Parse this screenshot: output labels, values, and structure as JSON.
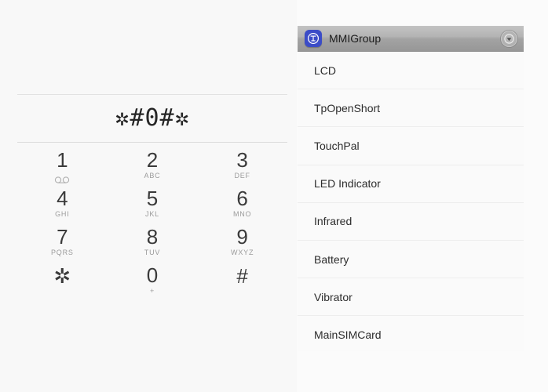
{
  "dialer": {
    "display_value": "✲#0#✲",
    "keys": [
      {
        "digit": "1",
        "sub": "",
        "icon": "voicemail-icon"
      },
      {
        "digit": "2",
        "sub": "ABC",
        "icon": ""
      },
      {
        "digit": "3",
        "sub": "DEF",
        "icon": ""
      },
      {
        "digit": "4",
        "sub": "GHI",
        "icon": ""
      },
      {
        "digit": "5",
        "sub": "JKL",
        "icon": ""
      },
      {
        "digit": "6",
        "sub": "MNO",
        "icon": ""
      },
      {
        "digit": "7",
        "sub": "PQRS",
        "icon": ""
      },
      {
        "digit": "8",
        "sub": "TUV",
        "icon": ""
      },
      {
        "digit": "9",
        "sub": "WXYZ",
        "icon": ""
      },
      {
        "digit": "✲",
        "sub": "",
        "icon": ""
      },
      {
        "digit": "0",
        "sub": "+",
        "icon": ""
      },
      {
        "digit": "#",
        "sub": "",
        "icon": ""
      }
    ]
  },
  "mmi": {
    "title": "MMIGroup",
    "app_icon": "mmi-app-icon",
    "menu_icon": "chevron-down-circle-icon",
    "accent_color": "#3b4cc7",
    "items": [
      {
        "label": "LCD"
      },
      {
        "label": "TpOpenShort"
      },
      {
        "label": "TouchPal"
      },
      {
        "label": "LED Indicator"
      },
      {
        "label": "Infrared"
      },
      {
        "label": "Battery"
      },
      {
        "label": "Vibrator"
      },
      {
        "label": "MainSIMCard"
      }
    ]
  }
}
